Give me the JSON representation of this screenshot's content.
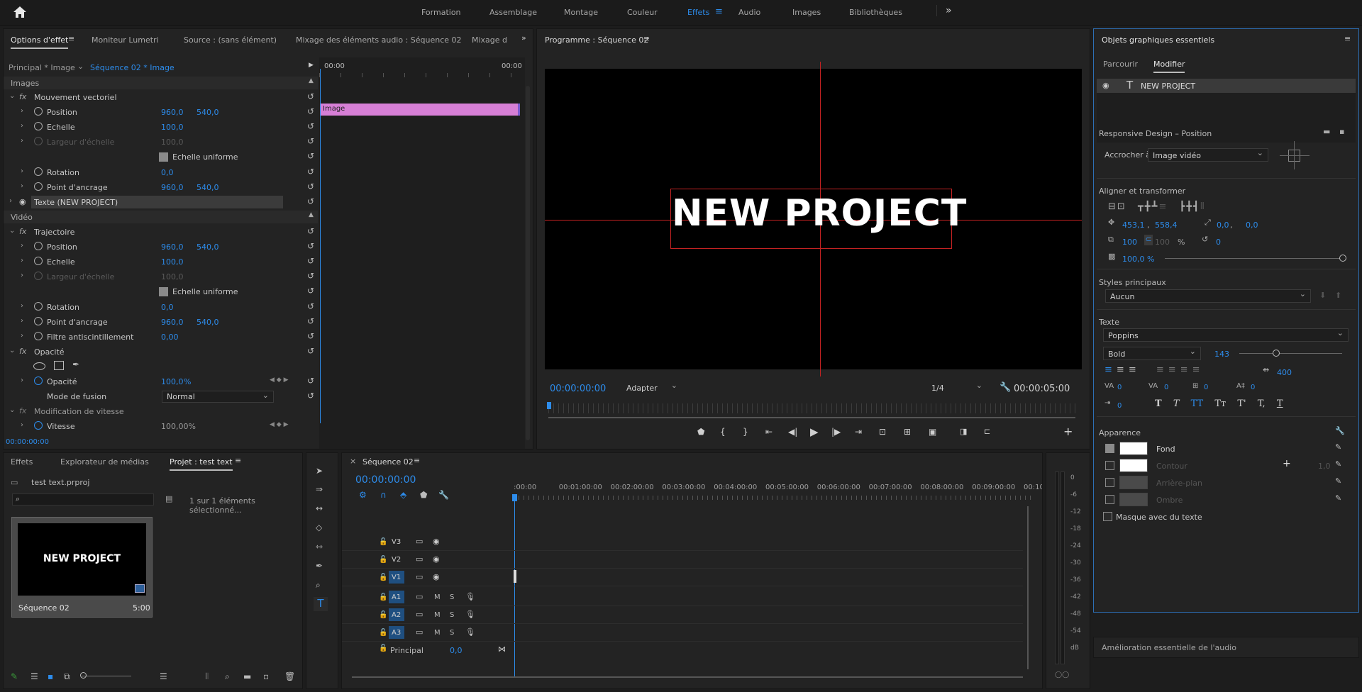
{
  "topbar": {
    "workspaces": [
      "Formation",
      "Assemblage",
      "Montage",
      "Couleur",
      "Effets",
      "Audio",
      "Images",
      "Bibliothèques"
    ],
    "active": "Effets"
  },
  "effect_panel": {
    "tabs": [
      "Options d'effet",
      "Moniteur Lumetri",
      "Source : (sans élément)",
      "Mixage des éléments audio : Séquence 02",
      "Mixage d"
    ],
    "breadcrumb_master": "Principal * Image",
    "breadcrumb_seq": "Séquence 02 * Image",
    "time_start": "00:00",
    "time_end": "00:00",
    "clip_label": "Image",
    "section_images": "Images",
    "section_video": "Vidéo",
    "motion_title": "Mouvement vectoriel",
    "rows_a": [
      {
        "label": "Position",
        "v1": "960,0",
        "v2": "540,0"
      },
      {
        "label": "Echelle",
        "v1": "100,0",
        "v2": ""
      },
      {
        "label": "Largeur d'échelle",
        "v1": "100,0",
        "v2": ""
      }
    ],
    "uniform_scale": "Echelle uniforme",
    "rows_b": [
      {
        "label": "Rotation",
        "v1": "0,0",
        "v2": ""
      },
      {
        "label": "Point d'ancrage",
        "v1": "960,0",
        "v2": "540,0"
      }
    ],
    "text_layer": "Texte (NEW PROJECT)",
    "trajectory_title": "Trajectoire",
    "rows_c": [
      {
        "label": "Position",
        "v1": "960,0",
        "v2": "540,0"
      },
      {
        "label": "Echelle",
        "v1": "100,0",
        "v2": ""
      },
      {
        "label": "Largeur d'échelle",
        "v1": "100,0",
        "v2": ""
      }
    ],
    "rows_d": [
      {
        "label": "Rotation",
        "v1": "0,0",
        "v2": ""
      },
      {
        "label": "Point d'ancrage",
        "v1": "960,0",
        "v2": "540,0"
      },
      {
        "label": "Filtre antiscintillement",
        "v1": "0,00",
        "v2": ""
      }
    ],
    "opacity_title": "Opacité",
    "opacity_label": "Opacité",
    "opacity_value": "100,0",
    "opacity_unit": "%",
    "blend_label": "Mode de fusion",
    "blend_value": "Normal",
    "speed_title": "Modification de vitesse",
    "speed_label": "Vitesse",
    "speed_value": "100,00%",
    "timecode": "00:00:00:00"
  },
  "program": {
    "title": "Programme : Séquence 02",
    "text": "NEW PROJECT",
    "timecode": "00:00:00:00",
    "fit": "Adapter",
    "quality": "1/4",
    "duration": "00:00:05:00"
  },
  "essential": {
    "title": "Objets graphiques essentiels",
    "tabs": [
      "Parcourir",
      "Modifier"
    ],
    "active_tab": "Modifier",
    "layer": "NEW PROJECT",
    "responsive": "Responsive Design – Position",
    "pin_label": "Accrocher à :",
    "pin_value": "Image vidéo",
    "align_title": "Aligner et transformer",
    "pos_x": "453,1",
    "pos_y": "558,4",
    "anchor_x": "0,0",
    "anchor_y": "0,0",
    "scale": "100",
    "scale_w": "100",
    "scale_unit": "%",
    "rotation": "0",
    "opacity": "100,0 %",
    "styles_title": "Styles principaux",
    "styles_value": "Aucun",
    "text_title": "Texte",
    "font": "Poppins",
    "weight": "Bold",
    "size": "143",
    "tracking_val": "400",
    "kern": [
      "0",
      "0",
      "0",
      "0"
    ],
    "baseline": "0",
    "text_style_labels": [
      "T",
      "T",
      "TT",
      "Tт",
      "T'",
      "T,",
      "T"
    ],
    "appearance_title": "Apparence",
    "fill": "Fond",
    "stroke": "Contour",
    "stroke_width": "1,0",
    "bg": "Arrière-plan",
    "shadow": "Ombre",
    "mask": "Masque avec du texte"
  },
  "audio_panel": {
    "title": "Amélioration essentielle de l'audio"
  },
  "project": {
    "tabs": [
      "Effets",
      "Explorateur de médias",
      "Projet : test text"
    ],
    "file": "test text.prproj",
    "count": "1 sur 1 éléments sélectionné...",
    "item_name": "Séquence 02",
    "item_duration": "5:00",
    "thumb_text": "NEW PROJECT"
  },
  "timeline": {
    "title": "Séquence 02",
    "timecode": "00:00:00:00",
    "ruler": [
      ":00:00",
      "00:01:00:00",
      "00:02:00:00",
      "00:03:00:00",
      "00:04:00:00",
      "00:05:00:00",
      "00:06:00:00",
      "00:07:00:00",
      "00:08:00:00",
      "00:09:00:00",
      "00:10"
    ],
    "video_tracks": [
      "V3",
      "V2",
      "V1"
    ],
    "audio_tracks": [
      "A1",
      "A2",
      "A3"
    ],
    "m": "M",
    "s": "S",
    "master": "Principal",
    "master_val": "0,0"
  },
  "meter": {
    "labels": [
      "0",
      "-6",
      "-12",
      "-18",
      "-24",
      "-30",
      "-36",
      "-42",
      "-48",
      "-54",
      "dB"
    ]
  }
}
